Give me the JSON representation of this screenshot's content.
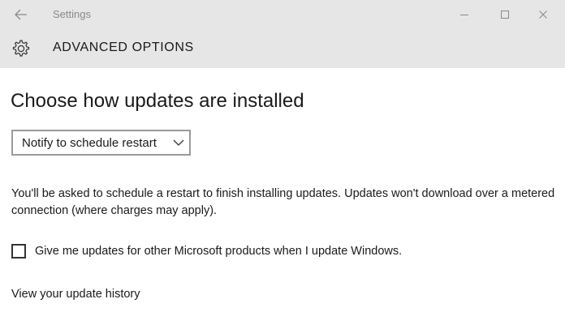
{
  "window": {
    "title": "Settings",
    "controls": [
      "minimize-icon",
      "maximize-icon",
      "close-icon"
    ],
    "back_icon": "arrow-left-icon"
  },
  "header": {
    "icon": "gear-icon",
    "title": "ADVANCED OPTIONS"
  },
  "main": {
    "heading": "Choose how updates are installed",
    "install_mode": {
      "selected": "Notify to schedule restart",
      "icon": "chevron-down-icon"
    },
    "description": "You'll be asked to schedule a restart to finish installing updates. Updates won't download over a metered connection (where charges may apply).",
    "other_products_checkbox": {
      "label": "Give me updates for other Microsoft products when I update Windows.",
      "checked": false
    },
    "history_link": "View your update history"
  },
  "colors": {
    "titlebar_bg": "#e6e6e6",
    "text": "#1a1a1a",
    "muted_text": "#8a8a8a"
  }
}
